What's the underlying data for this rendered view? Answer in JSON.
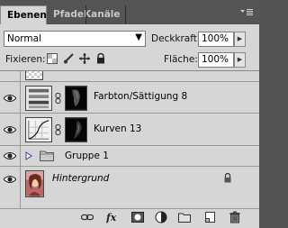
{
  "tabs": [
    {
      "label": "Ebenen"
    },
    {
      "label": "Pfade"
    },
    {
      "label": "Kanäle"
    }
  ],
  "blend_mode": {
    "value": "Normal"
  },
  "opacity": {
    "label": "Deckkraft:",
    "value": "100%"
  },
  "lock": {
    "label": "Fixieren:"
  },
  "fill": {
    "label": "Fläche:",
    "value": "100%"
  },
  "layers": [
    {
      "name": "Farbton/Sättigung 8"
    },
    {
      "name": "Kurven 13"
    },
    {
      "name": "Gruppe 1"
    },
    {
      "name": "Hintergrund"
    }
  ]
}
